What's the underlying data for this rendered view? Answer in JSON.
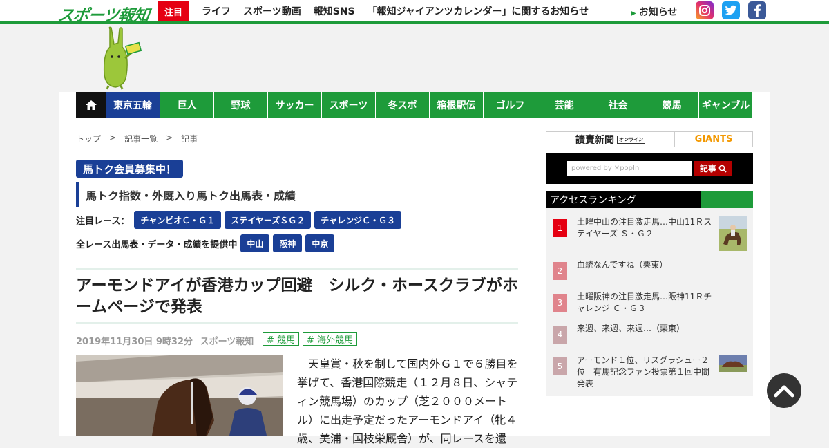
{
  "header": {
    "logo_text": "スポーツ報知",
    "attention_label": "注目",
    "links": [
      "ライフ",
      "スポーツ動画",
      "報知SNS",
      "「報知ジャイアンツカレンダー」に関するお知らせ"
    ],
    "notice_label": "お知らせ",
    "social": {
      "instagram": "instagram-icon",
      "twitter": "twitter-icon",
      "facebook": "facebook-icon"
    }
  },
  "nav": {
    "home_icon": "home-icon",
    "items": [
      "東京五輪",
      "巨人",
      "野球",
      "サッカー",
      "スポーツ",
      "冬スポ",
      "箱根駅伝",
      "ゴルフ",
      "芸能",
      "社会",
      "競馬",
      "ギャンブル"
    ],
    "active_index": 0
  },
  "breadcrumb": [
    "トップ",
    ">",
    "記事一覧",
    ">",
    "記事"
  ],
  "promo": {
    "badge": "馬トク会員募集中！",
    "subtitle": "馬トク指数・外厩入り馬トク出馬表・成績",
    "featured_label": "注目レース：",
    "featured_races": [
      "チャンピオＣ・Ｇ１",
      "ステイヤーズＳＧ２",
      "チャレンジＣ・Ｇ３"
    ],
    "all_races_label": "全レース出馬表・データ・成績を提供中",
    "venues": [
      "中山",
      "阪神",
      "中京"
    ]
  },
  "article": {
    "headline": "アーモンドアイが香港カップ回避　シルク・ホースクラブがホームページで発表",
    "date": "2019年11月30日 9時32分",
    "source": "スポーツ報知",
    "tags": [
      "# 競馬",
      "# 海外競馬"
    ],
    "body": "　天皇賞・秋を制して国内外Ｇ１で６勝目を挙げて、香港国際競走（１２月８日、シャティン競馬場）のカップ（芝２０００メートル）に出走予定だったアーモンドアイ（牝４歳、美浦・国枝栄厩舎）が、同レースを還"
  },
  "sidebar": {
    "yomiuri_label": "讀賣新聞",
    "yomiuri_sub": "オンライン",
    "giants_label": "GIANTS",
    "search_placeholder": "powered by ✕popIn",
    "search_button": "記事",
    "ranking_title": "アクセスランキング",
    "ranking": [
      {
        "rank": "1",
        "title": "土曜中山の注目激走馬…中山11Ｒステイヤーズ Ｓ・Ｇ２",
        "color": "#e50012"
      },
      {
        "rank": "2",
        "title": "血統なんですね（栗東）",
        "color": "#e0848c"
      },
      {
        "rank": "3",
        "title": "土曜阪神の注目激走馬…阪神11Ｒチャレンジ Ｃ・Ｇ３",
        "color": "#e0848c"
      },
      {
        "rank": "4",
        "title": "来週、来週、来週…（栗東）",
        "color": "#c9a6aa"
      },
      {
        "rank": "5",
        "title": "アーモンド１位、リスグラシュー２位　有馬記念ファン投票第１回中間発表",
        "color": "#c9a6aa"
      }
    ]
  },
  "to_top_icon": "chevron-up-icon",
  "colors": {
    "brand_green": "#1e9b3a",
    "navy": "#1a3f96",
    "attention_red": "#e50012"
  }
}
